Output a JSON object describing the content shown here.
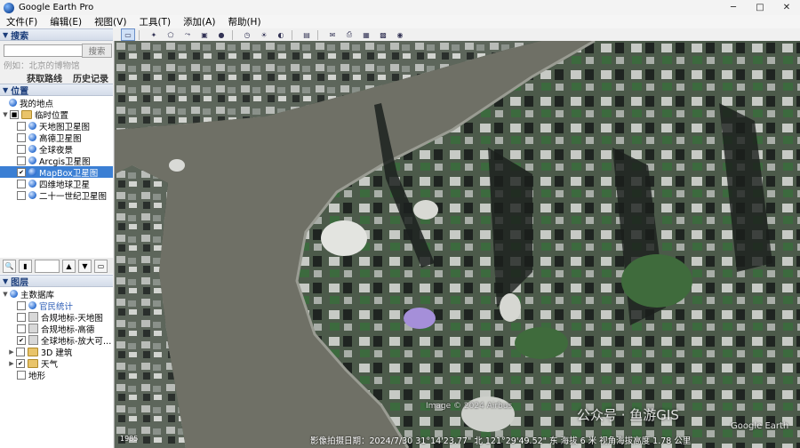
{
  "window": {
    "title": "Google Earth Pro",
    "minimize": "─",
    "maximize": "□",
    "close": "✕"
  },
  "menu": [
    "文件(F)",
    "编辑(E)",
    "视图(V)",
    "工具(T)",
    "添加(A)",
    "帮助(H)"
  ],
  "search": {
    "header": "搜索",
    "placeholder": "",
    "button": "搜索",
    "hint": "例如：北京的博物馆",
    "get_directions": "获取路线",
    "history": "历史记录"
  },
  "places": {
    "header": "位置",
    "my_places": "我的地点",
    "temp_places": "临时位置",
    "items": [
      {
        "label": "天地图卫星图",
        "checked": false,
        "selected": false
      },
      {
        "label": "高德卫星图",
        "checked": false,
        "selected": false
      },
      {
        "label": "全球夜景",
        "checked": false,
        "selected": false
      },
      {
        "label": "Arcgis卫星图",
        "checked": false,
        "selected": false
      },
      {
        "label": "MapBox卫星图",
        "checked": true,
        "selected": true
      },
      {
        "label": "四维地球卫星",
        "checked": false,
        "selected": false
      },
      {
        "label": "二十一世纪卫星图",
        "checked": false,
        "selected": false
      }
    ]
  },
  "layers": {
    "header": "图层",
    "root": "主数据库",
    "items": [
      {
        "label": "官民统计",
        "type": "link",
        "checked": false
      },
      {
        "label": "合规地标-天地图",
        "type": "layer",
        "checked": false
      },
      {
        "label": "合规地标-高德",
        "type": "layer",
        "checked": false
      },
      {
        "label": "全球地标-放大可…",
        "type": "layer",
        "checked": true
      },
      {
        "label": "3D 建筑",
        "type": "folder",
        "checked": false
      },
      {
        "label": "天气",
        "type": "folder",
        "checked": true
      },
      {
        "label": "地形",
        "type": "plain",
        "checked": false
      }
    ]
  },
  "map": {
    "copyright": "Image © 2024 Airbus",
    "year": "1985",
    "status": "影像拍摄日期：2024/7/30   31°14'23.77\" 北 121°29'49.52\" 东 海拔   6 米    视角海拔高度   1.78 公里",
    "watermark": "公众号 · 鱼游GIS",
    "logo": "Google Earth"
  },
  "colors": {
    "river": "#6f7066",
    "land": "#5b6559",
    "accent": "#3b7fd4",
    "header_text": "#1b3d7a"
  }
}
